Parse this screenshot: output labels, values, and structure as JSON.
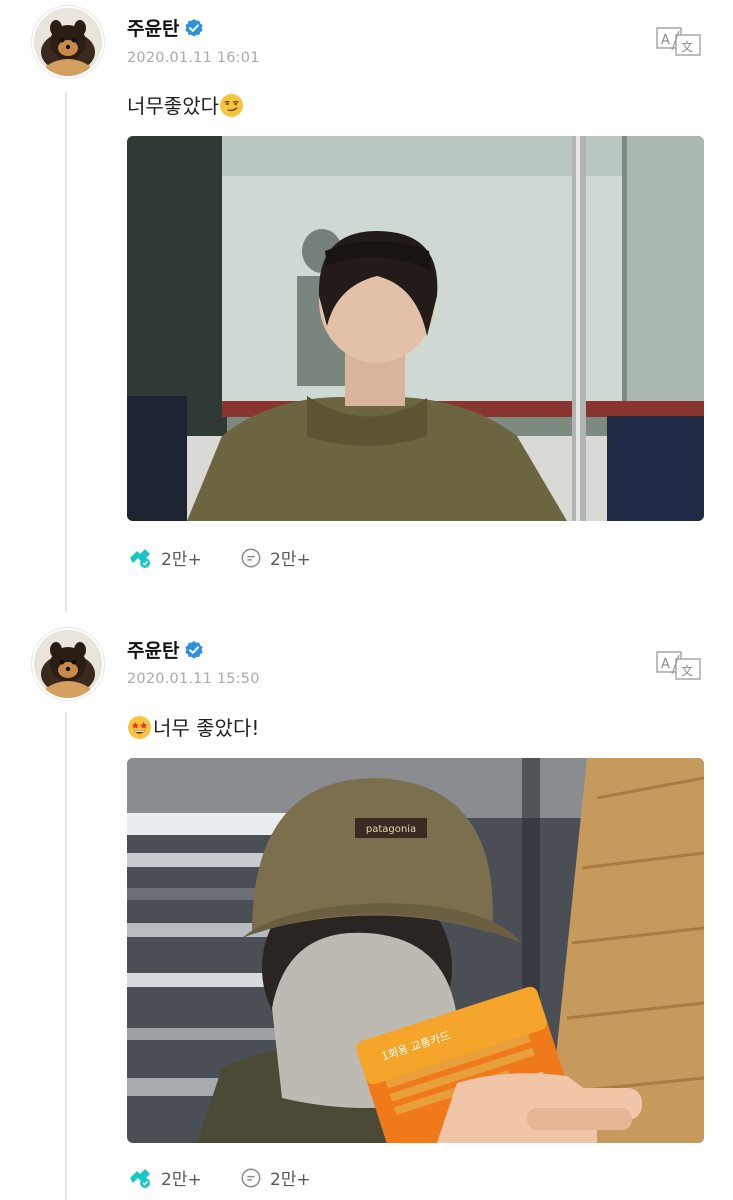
{
  "posts": [
    {
      "author": "주윤탄",
      "verified": true,
      "timestamp": "2020.01.11 16:01",
      "text": "너무좋았다",
      "emoji": "smirking-face",
      "emoji_position": "after",
      "photo": "subway-photo-puffer-jacket",
      "likes": "2만+",
      "comments": "2만+"
    },
    {
      "author": "주윤탄",
      "verified": true,
      "timestamp": "2020.01.11 15:50",
      "text": "너무 좋았다!",
      "emoji": "star-struck-face",
      "emoji_position": "before",
      "photo": "subway-selfie-cap-and-card",
      "photo_visible_text": [
        "patagonia",
        "1회용 교통카드"
      ],
      "likes": "2만+",
      "comments": "2만+"
    }
  ],
  "icons": {
    "translate": "translate-icon",
    "like": "like-icon",
    "comment": "comment-icon",
    "verified": "verified-badge-icon"
  },
  "colors": {
    "verified": "#2f8fd8",
    "like": "#19c6c6",
    "timestamp": "#a9a9b0",
    "text": "#1f1f1f"
  }
}
